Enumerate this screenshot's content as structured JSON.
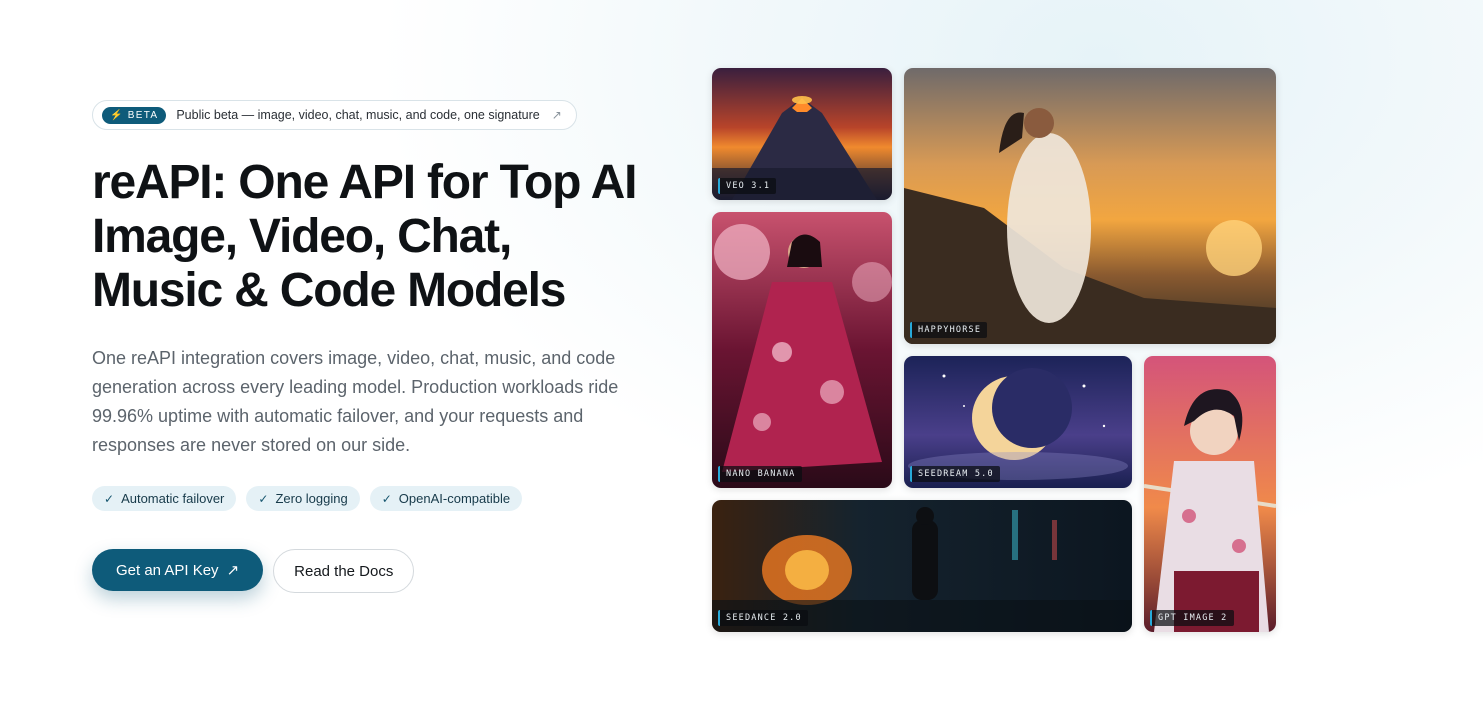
{
  "beta": {
    "badge": "BETA",
    "text": "Public beta — image, video, chat, music, and code, one signature"
  },
  "hero": {
    "title": "reAPI: One API for Top AI Image, Video, Chat, Music & Code Models",
    "description": "One reAPI integration covers image, video, chat, music, and code generation across every leading model. Production workloads ride 99.96% uptime with automatic failover, and your requests and responses are never stored on our side."
  },
  "features": [
    "Automatic failover",
    "Zero logging",
    "OpenAI-compatible"
  ],
  "cta": {
    "primary": "Get an API Key",
    "secondary": "Read the Docs"
  },
  "gallery": {
    "veo": "VEO 3.1",
    "happyhorse": "HAPPYHORSE",
    "nano": "NANO BANANA",
    "seedream": "SEEDREAM 5.0",
    "gpt": "GPT IMAGE 2",
    "seedance": "SEEDANCE 2.0"
  },
  "colors": {
    "accent": "#0e5b7a",
    "chip_bg": "#e5f1f6",
    "label_bar": "#27a9d9"
  }
}
